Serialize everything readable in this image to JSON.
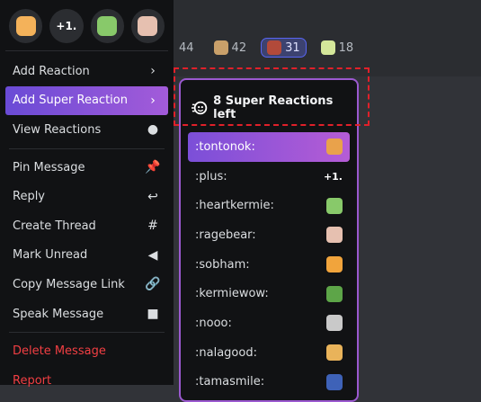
{
  "quick_reactions": [
    {
      "name": "tontonok-quick",
      "type": "emoji",
      "color": "#f4b25a"
    },
    {
      "name": "plus-one-quick",
      "type": "text",
      "text": "+1."
    },
    {
      "name": "heartkermie-quick",
      "type": "emoji",
      "color": "#88c96a"
    },
    {
      "name": "ragebear-quick",
      "type": "emoji",
      "color": "#e6c0b0"
    }
  ],
  "menu": [
    {
      "label": "Add Reaction",
      "icon": "chevron-right-icon",
      "glyph": "›"
    },
    {
      "label": "Add Super Reaction",
      "icon": "chevron-right-icon",
      "glyph": "›",
      "selected": true
    },
    {
      "label": "View Reactions",
      "icon": "face-icon",
      "glyph": "●"
    },
    {
      "label": "Pin Message",
      "icon": "pin-icon",
      "glyph": "📌"
    },
    {
      "label": "Reply",
      "icon": "reply-icon",
      "glyph": "↩"
    },
    {
      "label": "Create Thread",
      "icon": "thread-icon",
      "glyph": "#"
    },
    {
      "label": "Mark Unread",
      "icon": "mark-unread-icon",
      "glyph": "◀"
    },
    {
      "label": "Copy Message Link",
      "icon": "link-icon",
      "glyph": "🔗"
    },
    {
      "label": "Speak Message",
      "icon": "speak-icon",
      "glyph": "■"
    },
    {
      "label": "Delete Message",
      "danger": true
    },
    {
      "label": "Report",
      "danger": true
    }
  ],
  "reaction_bar": [
    {
      "count": "44",
      "color": "#00000000"
    },
    {
      "count": "42",
      "color": "#c9a06a"
    },
    {
      "count": "31",
      "color": "#b24a3a",
      "active": true
    },
    {
      "count": "18",
      "color": "#d4e79a"
    }
  ],
  "panel": {
    "header": "8 Super Reactions left",
    "emojis": [
      {
        "code": ":tontonok:",
        "color": "#e9a24b",
        "selected": true
      },
      {
        "code": ":plus:",
        "text": "+1."
      },
      {
        "code": ":heartkermie:",
        "color": "#88c96a"
      },
      {
        "code": ":ragebear:",
        "color": "#e6c0b0"
      },
      {
        "code": ":sobham:",
        "color": "#f1a43c"
      },
      {
        "code": ":kermiewow:",
        "color": "#5da548"
      },
      {
        "code": ":nooo:",
        "color": "#c9c9c9"
      },
      {
        "code": ":nalagood:",
        "color": "#e9b35a"
      },
      {
        "code": ":tamasmile:",
        "color": "#3e62b8"
      }
    ]
  },
  "colors": {
    "accent": "#5865f2",
    "super": "#9b59d0",
    "danger": "#f23f43",
    "highlight_box": "#e0202a"
  }
}
